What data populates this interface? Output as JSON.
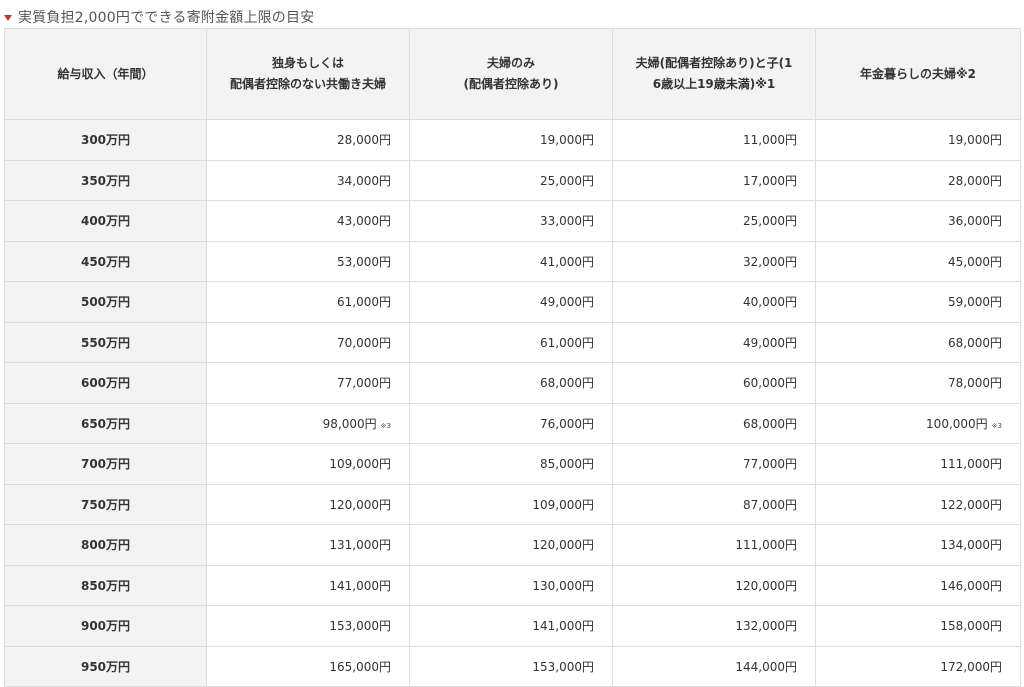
{
  "title": "実質負担2,000円でできる寄附金額上限の目安",
  "headers": [
    "給与収入（年間）",
    "独身もしくは\n配偶者控除のない共働き夫婦",
    "夫婦のみ\n(配偶者控除あり)",
    "夫婦(配偶者控除あり)と子(1\n6歳以上19歳未満)※1",
    "年金暮らしの夫婦※2"
  ],
  "rows": [
    {
      "income": "300万円",
      "single": "28,000円",
      "couple": "19,000円",
      "couple_child": "11,000円",
      "pension": "19,000円"
    },
    {
      "income": "350万円",
      "single": "34,000円",
      "couple": "25,000円",
      "couple_child": "17,000円",
      "pension": "28,000円"
    },
    {
      "income": "400万円",
      "single": "43,000円",
      "couple": "33,000円",
      "couple_child": "25,000円",
      "pension": "36,000円"
    },
    {
      "income": "450万円",
      "single": "53,000円",
      "couple": "41,000円",
      "couple_child": "32,000円",
      "pension": "45,000円"
    },
    {
      "income": "500万円",
      "single": "61,000円",
      "couple": "49,000円",
      "couple_child": "40,000円",
      "pension": "59,000円"
    },
    {
      "income": "550万円",
      "single": "70,000円",
      "couple": "61,000円",
      "couple_child": "49,000円",
      "pension": "68,000円"
    },
    {
      "income": "600万円",
      "single": "77,000円",
      "couple": "68,000円",
      "couple_child": "60,000円",
      "pension": "78,000円"
    },
    {
      "income": "650万円",
      "single": "98,000円",
      "single_note": "※3",
      "couple": "76,000円",
      "couple_child": "68,000円",
      "pension": "100,000円",
      "pension_note": "※3"
    },
    {
      "income": "700万円",
      "single": "109,000円",
      "couple": "85,000円",
      "couple_child": "77,000円",
      "pension": "111,000円"
    },
    {
      "income": "750万円",
      "single": "120,000円",
      "couple": "109,000円",
      "couple_child": "87,000円",
      "pension": "122,000円"
    },
    {
      "income": "800万円",
      "single": "131,000円",
      "couple": "120,000円",
      "couple_child": "111,000円",
      "pension": "134,000円"
    },
    {
      "income": "850万円",
      "single": "141,000円",
      "couple": "130,000円",
      "couple_child": "120,000円",
      "pension": "146,000円"
    },
    {
      "income": "900万円",
      "single": "153,000円",
      "couple": "141,000円",
      "couple_child": "132,000円",
      "pension": "158,000円"
    },
    {
      "income": "950万円",
      "single": "165,000円",
      "couple": "153,000円",
      "couple_child": "144,000円",
      "pension": "172,000円"
    }
  ],
  "colors": {
    "accent": "#c0392b",
    "header_bg": "#f3f3f3",
    "border": "#dddddd"
  }
}
